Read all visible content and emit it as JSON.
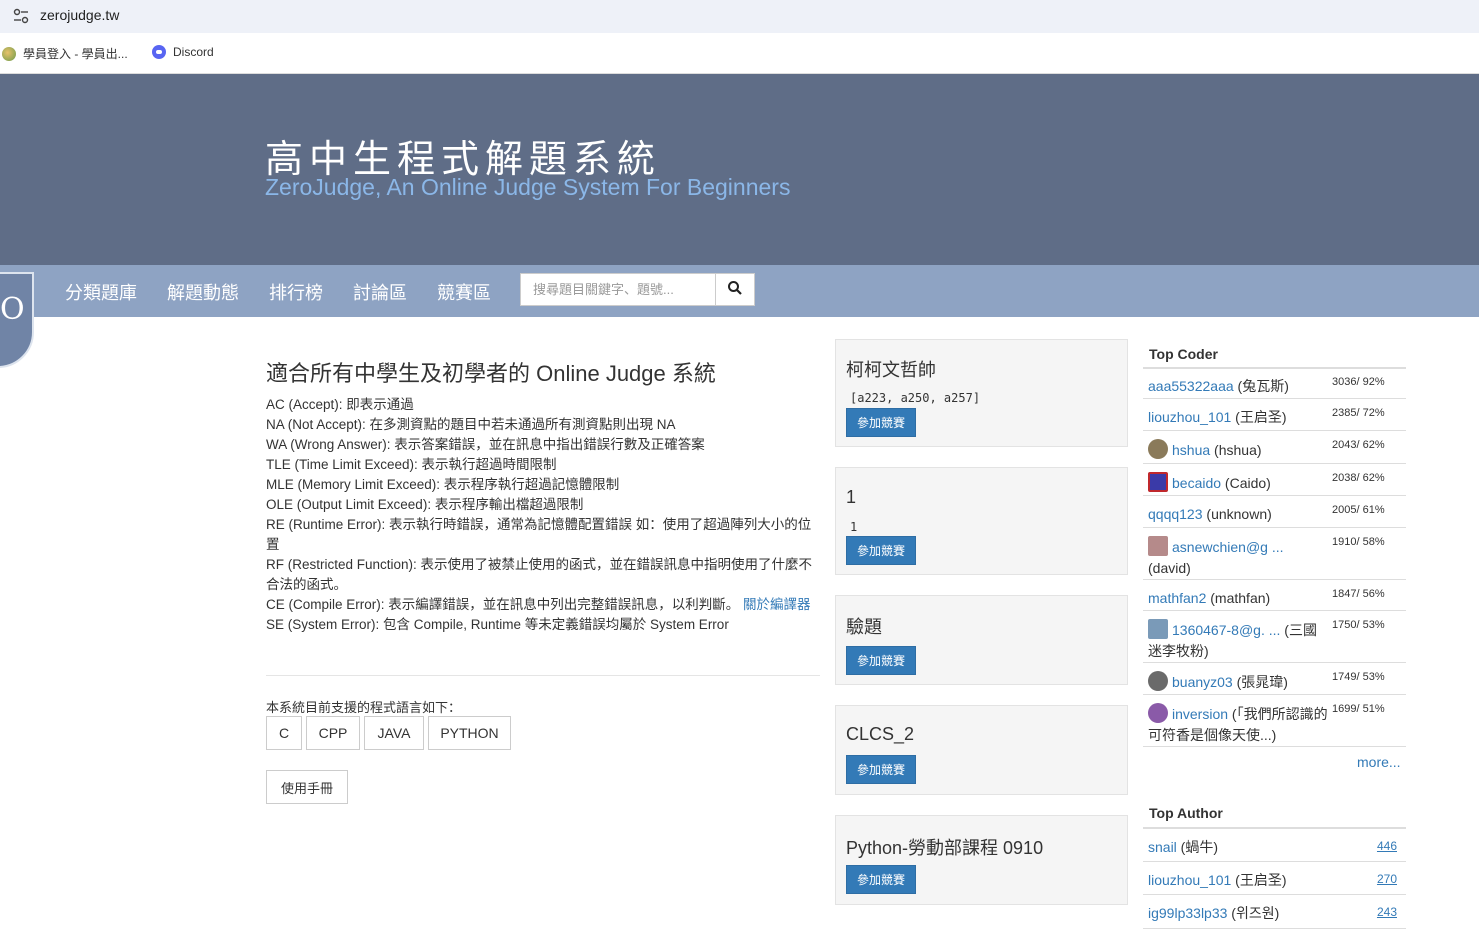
{
  "browser": {
    "url": "zerojudge.tw",
    "bookmarks": [
      {
        "label": "學員登入 - 學員出..."
      },
      {
        "label": "Discord"
      }
    ]
  },
  "header": {
    "title": "高中生程式解題系統",
    "subtitle": "ZeroJudge, An Online Judge System For Beginners"
  },
  "nav": {
    "items": [
      "分類題庫",
      "解題動態",
      "排行榜",
      "討論區",
      "競賽區"
    ],
    "search_placeholder": "搜尋題目關鍵字、題號..."
  },
  "main": {
    "heading": "適合所有中學生及初學者的 Online Judge 系統",
    "statuses": [
      "AC (Accept): 即表示通過",
      "NA (Not Accept): 在多測資點的題目中若未通過所有測資點則出現 NA",
      "WA (Wrong Answer): 表示答案錯誤，並在訊息中指出錯誤行數及正確答案",
      "TLE (Time Limit Exceed): 表示執行超過時間限制",
      "MLE (Memory Limit Exceed): 表示程序執行超過記憶體限制",
      "OLE (Output Limit Exceed): 表示程序輸出檔超過限制",
      "RE (Runtime Error): 表示執行時錯誤，通常為記憶體配置錯誤 如：使用了超過陣列大小的位置",
      "RF (Restricted Function): 表示使用了被禁止使用的函式，並在錯誤訊息中指明使用了什麼不合法的函式。",
      "CE (Compile Error): 表示編譯錯誤，並在訊息中列出完整錯誤訊息，以利判斷。",
      "SE (System Error): 包含 Compile, Runtime 等未定義錯誤均屬於 System Error"
    ],
    "ce_link": "關於編譯器",
    "lang_intro": "本系統目前支援的程式語言如下：",
    "languages": [
      "C",
      "CPP",
      "JAVA",
      "PYTHON"
    ],
    "manual_button": "使用手冊"
  },
  "contests": [
    {
      "title": "柯柯文哲帥",
      "sub": "[a223, a250, a257]",
      "button": "參加競賽"
    },
    {
      "title": "1",
      "sub": "1",
      "button": "參加競賽"
    },
    {
      "title": "驗題",
      "sub": "",
      "button": "參加競賽"
    },
    {
      "title": "CLCS_2",
      "sub": "",
      "button": "參加競賽"
    },
    {
      "title": "Python-勞動部課程 0910",
      "sub": "",
      "button": "參加競賽"
    }
  ],
  "top_coder": {
    "heading": "Top Coder",
    "rows": [
      {
        "user": "aaa55322aaa",
        "nick": " (兔瓦斯)",
        "stat": "3036/ 92%",
        "avatar": ""
      },
      {
        "user": "liouzhou_101",
        "nick": " (王启圣)",
        "stat": "2385/ 72%",
        "avatar": ""
      },
      {
        "user": "hshua",
        "nick": " (hshua)",
        "stat": "2043/ 62%",
        "avatar": "#8a7a5a"
      },
      {
        "user": "becaido",
        "nick": " (Caido)",
        "stat": "2038/ 62%",
        "avatar": "#3a3aa8"
      },
      {
        "user": "qqqq123",
        "nick": " (unknown)",
        "stat": "2005/ 61%",
        "avatar": ""
      },
      {
        "user": "asnewchien@g ...",
        "nick": " (david)",
        "stat": "1910/ 58%",
        "avatar": "#b58a8a"
      },
      {
        "user": "mathfan2",
        "nick": " (mathfan)",
        "stat": "1847/ 56%",
        "avatar": ""
      },
      {
        "user": "1360467-8@g. ...",
        "nick": " (三國迷李牧粉)",
        "stat": "1750/ 53%",
        "avatar": "#7a9ab8"
      },
      {
        "user": "buanyz03",
        "nick": " (張晁瑋)",
        "stat": "1749/ 53%",
        "avatar": "#6a6a6a"
      },
      {
        "user": "inversion",
        "nick": " (「我們所認識的可符香是個像天使...)",
        "stat": "1699/ 51%",
        "avatar": "#8a5aa8"
      }
    ],
    "more": "more..."
  },
  "top_author": {
    "heading": "Top Author",
    "rows": [
      {
        "user": "snail",
        "nick": " (蝸牛)",
        "count": "446"
      },
      {
        "user": "liouzhou_101",
        "nick": " (王启圣)",
        "count": "270"
      },
      {
        "user": "ig99lp33lp33",
        "nick": " (위즈원)",
        "count": "243"
      }
    ]
  }
}
